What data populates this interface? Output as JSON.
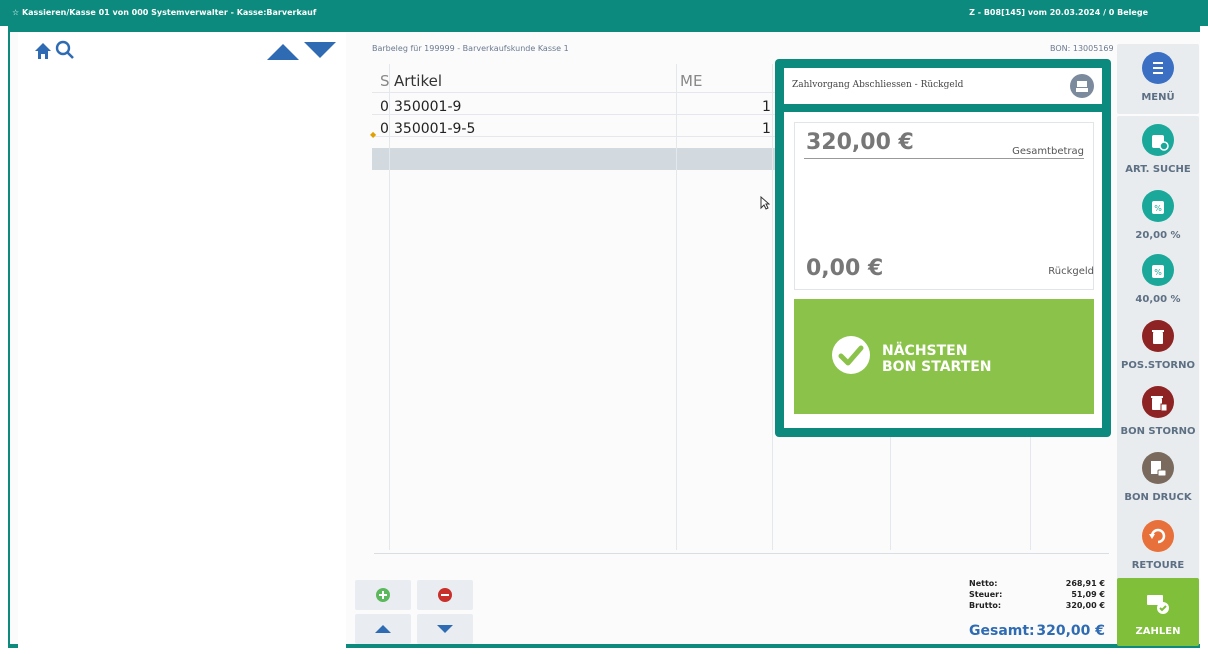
{
  "titlebar": {
    "left": "☆ Kassieren/Kasse 01 von 000 Systemverwalter - Kasse:Barverkauf",
    "right": "Z - B08[145] vom 20.03.2024 / 0 Belege"
  },
  "receipt": {
    "header": "Barbeleg für 199999 - Barverkaufskunde Kasse 1",
    "bon_no": "BON: 13005169",
    "columns": [
      "S",
      "Artikel",
      "ME"
    ],
    "rows": [
      {
        "s": "0",
        "artikel": "350001-9",
        "me": "1"
      },
      {
        "s": "0",
        "artikel": "350001-9-5",
        "me": "1"
      }
    ]
  },
  "totals": {
    "netto_label": "Netto:",
    "netto": "268,91 €",
    "steuer_label": "Steuer:",
    "steuer": "51,09 €",
    "brutto_label": "Brutto:",
    "brutto": "320,00 €",
    "gesamt_label": "Gesamt:",
    "gesamt": "320,00 €"
  },
  "dialog": {
    "title": "Zahlvorgang Abschliessen - Rückgeld",
    "total_amount": "320,00 €",
    "total_label": "Gesamtbetrag",
    "change_amount": "0,00 €",
    "change_label": "Rückgeld",
    "next_button_line1": "NÄCHSTEN",
    "next_button_line2": "BON STARTEN"
  },
  "sidebar": {
    "menu": "MENÜ",
    "art_suche": "ART. SUCHE",
    "rabatt20": "20,00 %",
    "rabatt40": "40,00 %",
    "pos_storno": "POS.STORNO",
    "bon_storno": "BON STORNO",
    "bon_druck": "BON DRUCK",
    "retoure": "RETOURE",
    "zahlen": "ZAHLEN"
  },
  "colors": {
    "teal": "#0c8a7d",
    "blue": "#2f6bb3",
    "green": "#8bc34a",
    "red": "#a32d2d"
  }
}
